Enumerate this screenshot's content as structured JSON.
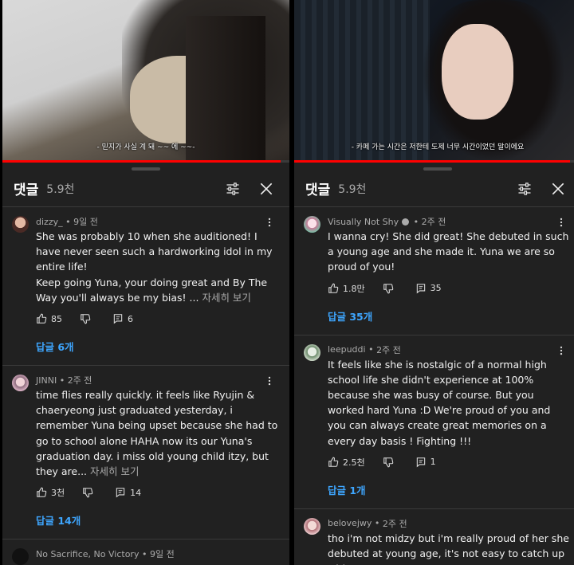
{
  "left": {
    "video": {
      "subtitle": "- 믿지가 사실 계 돼 ~~ 에 ~~-"
    },
    "header": {
      "title": "댓글",
      "count": "5.9천"
    },
    "comments": [
      {
        "author": "dizzy_",
        "time": "9일 전",
        "text": "She was probably 10 when she auditioned! I have never seen such a hardworking idol in my entire life!\nKeep going Yuna, your doing great and By The Way you'll always be my bias! ...",
        "more": "자세히 보기",
        "likes": "85",
        "replies_icon_count": "6",
        "replies_label": "답글 6개"
      },
      {
        "author": "JINNI",
        "time": "2주 전",
        "text": "time flies really quickly. it feels like Ryujin & chaeryeong just graduated yesterday, i remember Yuna being upset because she had to go to school alone HAHA now its our Yuna's graduation day. i miss old young child itzy, but they are...",
        "more": "자세히 보기",
        "likes": "3천",
        "replies_icon_count": "14",
        "replies_label": "답글 14개"
      },
      {
        "author": "No Sacrifice, No Victory",
        "time": "9일 전"
      }
    ]
  },
  "right": {
    "video": {
      "subtitle": "- 카페 가는 시간은 저한테 도제 너무 시간이었던 말이에요"
    },
    "header": {
      "title": "댓글",
      "count": "5.9천"
    },
    "comments": [
      {
        "author": "Visually Not Shy",
        "time": "2주 전",
        "text": "I wanna cry! She did great! She debuted in such a young age and she made it. Yuna we are so proud of you!",
        "likes": "1.8만",
        "replies_icon_count": "35",
        "replies_label": "답글 35개"
      },
      {
        "author": "leepuddi",
        "time": "2주 전",
        "text": "It feels like she is nostalgic of a normal high school life she didn't experience at 100% because she was busy of course. But you worked hard Yuna :D We're proud of you and you can always create great memories on a every day basis ! Fighting !!!",
        "likes": "2.5천",
        "replies_icon_count": "1",
        "replies_label": "답글 1개"
      },
      {
        "author": "belovejwy",
        "time": "2주 전",
        "text": "tho i'm not midzy but i'm really proud of her she debuted at young age, it's not easy to catch up with"
      }
    ]
  },
  "colors": {
    "background": "#212121",
    "link": "#3ea6ff",
    "progress": "#ff0000",
    "secondary_text": "#aaaaaa"
  },
  "icons": [
    "filter-icon",
    "close-icon",
    "kebab-menu-icon",
    "like-icon",
    "dislike-icon",
    "reply-icon",
    "verified-icon"
  ]
}
